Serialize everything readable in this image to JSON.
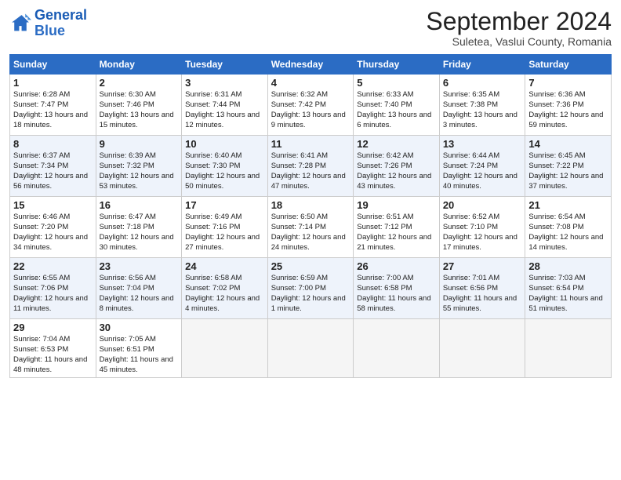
{
  "header": {
    "logo_general": "General",
    "logo_blue": "Blue",
    "month_title": "September 2024",
    "subtitle": "Suletea, Vaslui County, Romania"
  },
  "days_of_week": [
    "Sunday",
    "Monday",
    "Tuesday",
    "Wednesday",
    "Thursday",
    "Friday",
    "Saturday"
  ],
  "weeks": [
    [
      {
        "day": 1,
        "sunrise": "6:28 AM",
        "sunset": "7:47 PM",
        "daylight": "13 hours and 18 minutes."
      },
      {
        "day": 2,
        "sunrise": "6:30 AM",
        "sunset": "7:46 PM",
        "daylight": "13 hours and 15 minutes."
      },
      {
        "day": 3,
        "sunrise": "6:31 AM",
        "sunset": "7:44 PM",
        "daylight": "13 hours and 12 minutes."
      },
      {
        "day": 4,
        "sunrise": "6:32 AM",
        "sunset": "7:42 PM",
        "daylight": "13 hours and 9 minutes."
      },
      {
        "day": 5,
        "sunrise": "6:33 AM",
        "sunset": "7:40 PM",
        "daylight": "13 hours and 6 minutes."
      },
      {
        "day": 6,
        "sunrise": "6:35 AM",
        "sunset": "7:38 PM",
        "daylight": "13 hours and 3 minutes."
      },
      {
        "day": 7,
        "sunrise": "6:36 AM",
        "sunset": "7:36 PM",
        "daylight": "12 hours and 59 minutes."
      }
    ],
    [
      {
        "day": 8,
        "sunrise": "6:37 AM",
        "sunset": "7:34 PM",
        "daylight": "12 hours and 56 minutes."
      },
      {
        "day": 9,
        "sunrise": "6:39 AM",
        "sunset": "7:32 PM",
        "daylight": "12 hours and 53 minutes."
      },
      {
        "day": 10,
        "sunrise": "6:40 AM",
        "sunset": "7:30 PM",
        "daylight": "12 hours and 50 minutes."
      },
      {
        "day": 11,
        "sunrise": "6:41 AM",
        "sunset": "7:28 PM",
        "daylight": "12 hours and 47 minutes."
      },
      {
        "day": 12,
        "sunrise": "6:42 AM",
        "sunset": "7:26 PM",
        "daylight": "12 hours and 43 minutes."
      },
      {
        "day": 13,
        "sunrise": "6:44 AM",
        "sunset": "7:24 PM",
        "daylight": "12 hours and 40 minutes."
      },
      {
        "day": 14,
        "sunrise": "6:45 AM",
        "sunset": "7:22 PM",
        "daylight": "12 hours and 37 minutes."
      }
    ],
    [
      {
        "day": 15,
        "sunrise": "6:46 AM",
        "sunset": "7:20 PM",
        "daylight": "12 hours and 34 minutes."
      },
      {
        "day": 16,
        "sunrise": "6:47 AM",
        "sunset": "7:18 PM",
        "daylight": "12 hours and 30 minutes."
      },
      {
        "day": 17,
        "sunrise": "6:49 AM",
        "sunset": "7:16 PM",
        "daylight": "12 hours and 27 minutes."
      },
      {
        "day": 18,
        "sunrise": "6:50 AM",
        "sunset": "7:14 PM",
        "daylight": "12 hours and 24 minutes."
      },
      {
        "day": 19,
        "sunrise": "6:51 AM",
        "sunset": "7:12 PM",
        "daylight": "12 hours and 21 minutes."
      },
      {
        "day": 20,
        "sunrise": "6:52 AM",
        "sunset": "7:10 PM",
        "daylight": "12 hours and 17 minutes."
      },
      {
        "day": 21,
        "sunrise": "6:54 AM",
        "sunset": "7:08 PM",
        "daylight": "12 hours and 14 minutes."
      }
    ],
    [
      {
        "day": 22,
        "sunrise": "6:55 AM",
        "sunset": "7:06 PM",
        "daylight": "12 hours and 11 minutes."
      },
      {
        "day": 23,
        "sunrise": "6:56 AM",
        "sunset": "7:04 PM",
        "daylight": "12 hours and 8 minutes."
      },
      {
        "day": 24,
        "sunrise": "6:58 AM",
        "sunset": "7:02 PM",
        "daylight": "12 hours and 4 minutes."
      },
      {
        "day": 25,
        "sunrise": "6:59 AM",
        "sunset": "7:00 PM",
        "daylight": "12 hours and 1 minute."
      },
      {
        "day": 26,
        "sunrise": "7:00 AM",
        "sunset": "6:58 PM",
        "daylight": "11 hours and 58 minutes."
      },
      {
        "day": 27,
        "sunrise": "7:01 AM",
        "sunset": "6:56 PM",
        "daylight": "11 hours and 55 minutes."
      },
      {
        "day": 28,
        "sunrise": "7:03 AM",
        "sunset": "6:54 PM",
        "daylight": "11 hours and 51 minutes."
      }
    ],
    [
      {
        "day": 29,
        "sunrise": "7:04 AM",
        "sunset": "6:53 PM",
        "daylight": "11 hours and 48 minutes."
      },
      {
        "day": 30,
        "sunrise": "7:05 AM",
        "sunset": "6:51 PM",
        "daylight": "11 hours and 45 minutes."
      },
      null,
      null,
      null,
      null,
      null
    ]
  ]
}
